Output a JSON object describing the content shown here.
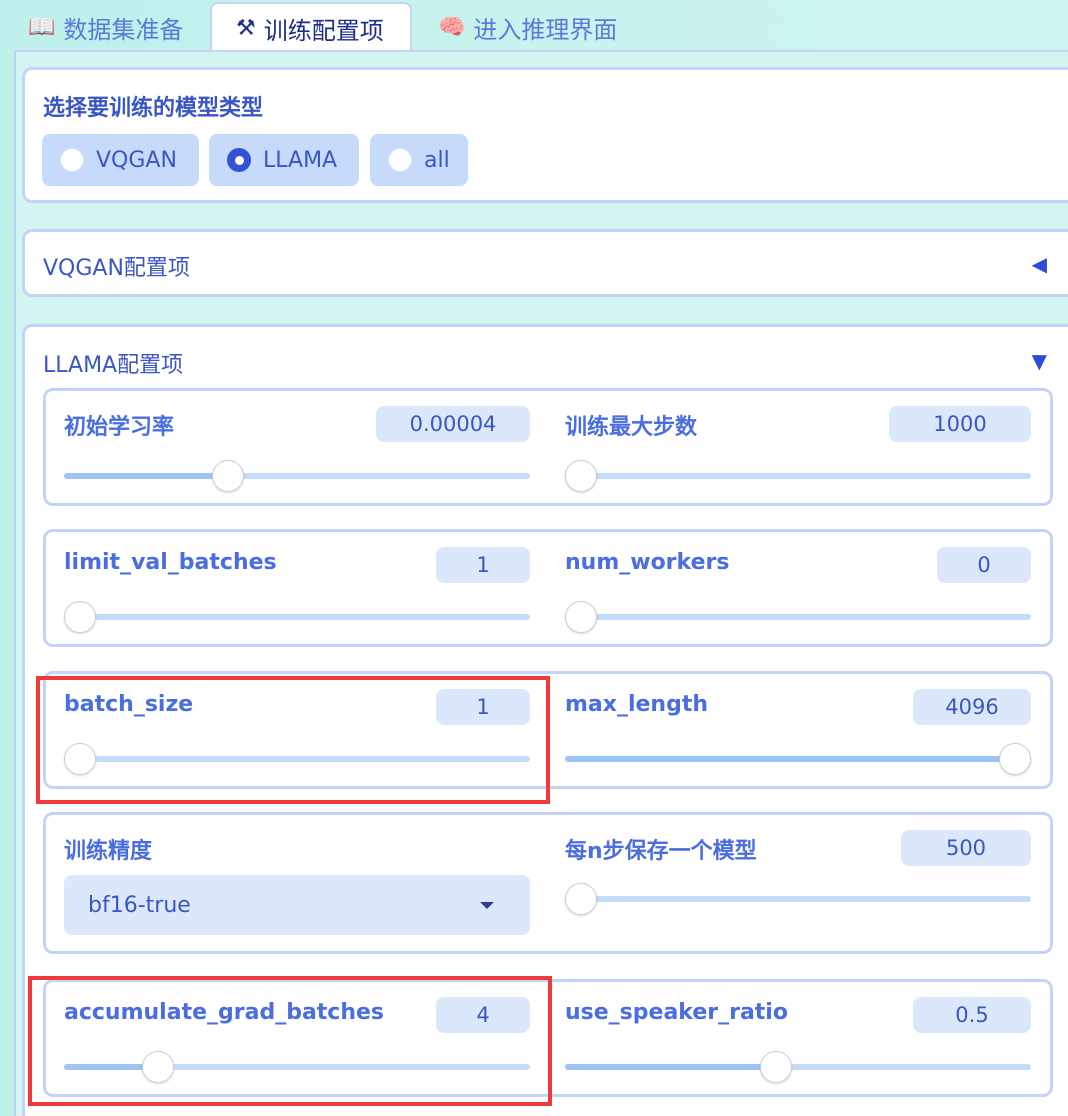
{
  "tabs": [
    {
      "icon": "📖",
      "label": "数据集准备"
    },
    {
      "icon": "⚒",
      "label": "训练配置项"
    },
    {
      "icon": "🧠",
      "label": "进入推理界面"
    }
  ],
  "model_type": {
    "title": "选择要训练的模型类型",
    "options": [
      "VQGAN",
      "LLAMA",
      "all"
    ],
    "selected": "LLAMA"
  },
  "vqgan_section": {
    "title": "VQGAN配置项",
    "arrow": "◀"
  },
  "llama_section": {
    "title": "LLAMA配置项",
    "arrow": "▼",
    "fields": {
      "lr": {
        "label": "初始学习率",
        "value": "0.00004",
        "level": 0.34
      },
      "max_steps": {
        "label": "训练最大步数",
        "value": "1000",
        "level": 0.0
      },
      "limit_val_batches": {
        "label": "limit_val_batches",
        "value": "1",
        "level": 0.0
      },
      "num_workers": {
        "label": "num_workers",
        "value": "0",
        "level": 0.0
      },
      "batch_size": {
        "label": "batch_size",
        "value": "1",
        "level": 0.0
      },
      "max_length": {
        "label": "max_length",
        "value": "4096",
        "level": 1.0
      },
      "precision": {
        "label": "训练精度",
        "value": "bf16-true"
      },
      "save_every": {
        "label": "每n步保存一个模型",
        "value": "500",
        "level": 0.0
      },
      "accumulate_grad_batches": {
        "label": "accumulate_grad_batches",
        "value": "4",
        "level": 0.18
      },
      "use_speaker_ratio": {
        "label": "use_speaker_ratio",
        "value": "0.5",
        "level": 0.45
      }
    }
  },
  "colors": {
    "accent": "#3652d4",
    "highlight": "#f0393a",
    "track": "#c6dbfb",
    "fill": "#9ec3f5"
  }
}
